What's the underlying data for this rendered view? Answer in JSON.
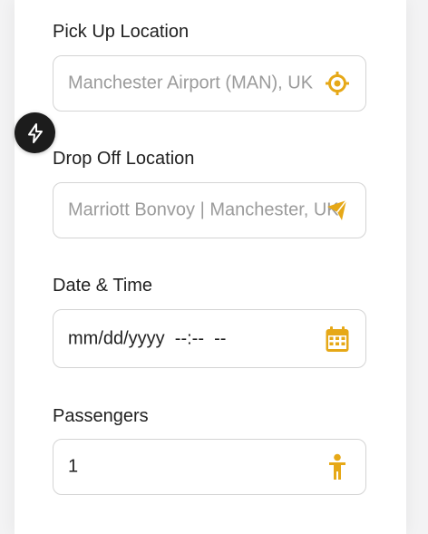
{
  "colors": {
    "accent": "#E6A817",
    "border": "#d4d4d4",
    "text": "#1f1f1f",
    "placeholder": "#9b9b9b"
  },
  "pickup": {
    "label": "Pick Up Location",
    "placeholder": "Manchester Airport (MAN), UK",
    "icon": "crosshair-icon"
  },
  "dropoff": {
    "label": "Drop Off Location",
    "placeholder": "Marriott Bonvoy | Manchester, UK",
    "icon": "plane-icon"
  },
  "datetime": {
    "label": "Date & Time",
    "value": "mm/dd/yyyy  --:--  --",
    "icon": "calendar-icon"
  },
  "passengers": {
    "label": "Passengers",
    "value": "1",
    "icon": "person-icon"
  },
  "floating_action": {
    "icon": "lightning-icon"
  }
}
